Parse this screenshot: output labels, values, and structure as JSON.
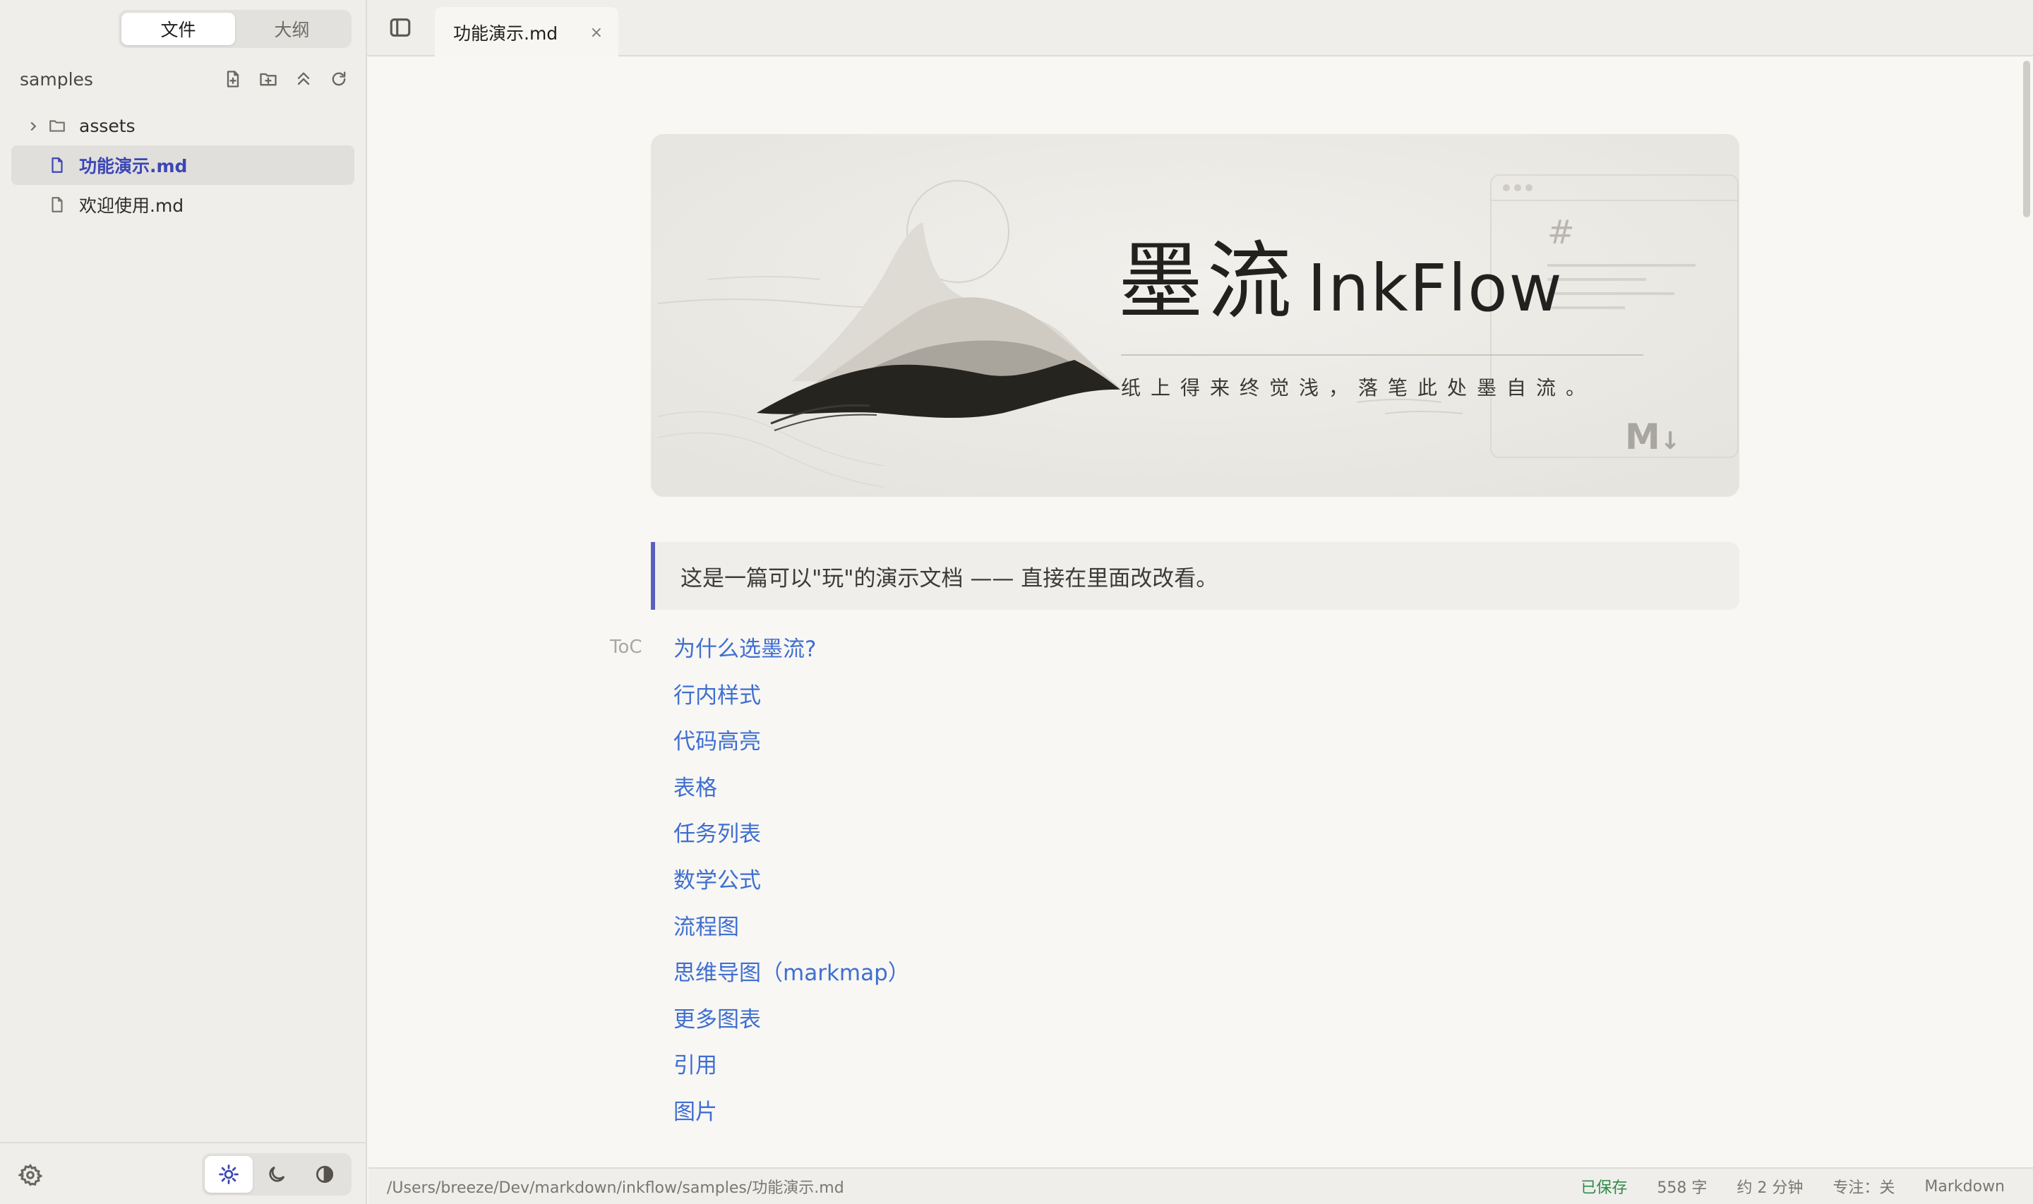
{
  "sidebar": {
    "tabs": [
      {
        "label": "文件",
        "active": true
      },
      {
        "label": "大纲",
        "active": false
      }
    ],
    "folder_name": "samples",
    "tools": [
      "new-file-icon",
      "new-folder-icon",
      "collapse-all-icon",
      "refresh-icon"
    ],
    "tree": [
      {
        "label": "assets",
        "type": "folder",
        "expanded": false
      },
      {
        "label": "功能演示.md",
        "type": "file",
        "active": true
      },
      {
        "label": "欢迎使用.md",
        "type": "file",
        "active": false
      }
    ],
    "theme_modes": [
      "light",
      "dark",
      "contrast"
    ],
    "active_theme": "light"
  },
  "tabbar": {
    "tab_label": "功能演示.md",
    "close_glyph": "×"
  },
  "editor": {
    "banner": {
      "title_cn": "墨流",
      "title_en": "InkFlow",
      "subtitle": "纸上得来终觉浅，落笔此处墨自流。",
      "hash_glyph": "#",
      "md_mark": "M",
      "md_arrow": "↓"
    },
    "quote": "这是一篇可以\"玩\"的演示文档 —— 直接在里面改改看。",
    "toc_label": "ToC",
    "toc": [
      "为什么选墨流?",
      "行内样式",
      "代码高亮",
      "表格",
      "任务列表",
      "数学公式",
      "流程图",
      "思维导图（markmap）",
      "更多图表",
      "引用",
      "图片"
    ]
  },
  "status": {
    "path": "/Users/breeze/Dev/markdown/inkflow/samples/功能演示.md",
    "saved": "已保存",
    "word_count": "558 字",
    "read_time": "约 2 分钟",
    "focus": "专注：关",
    "mode": "Markdown"
  },
  "colors": {
    "accent": "#3b47b5",
    "link": "#3f6fd1",
    "quote_border": "#5a5fbf",
    "saved": "#2e8b4a"
  }
}
